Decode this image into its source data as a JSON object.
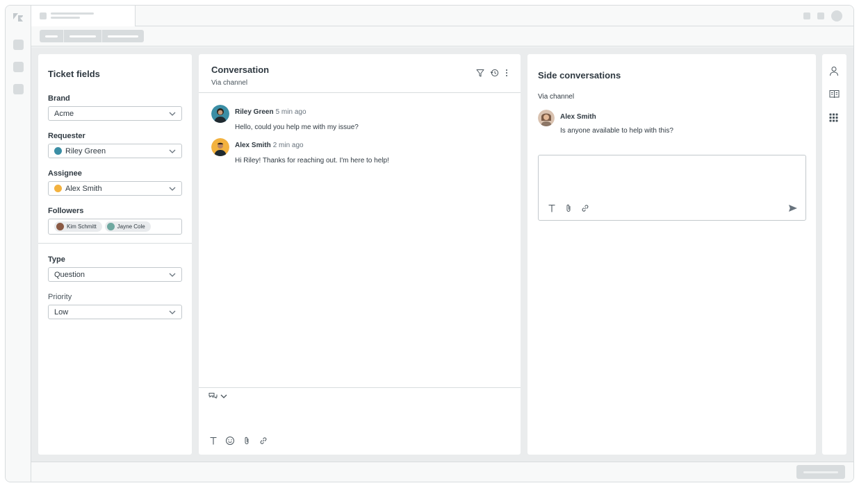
{
  "fields": {
    "title": "Ticket fields",
    "brand": {
      "label": "Brand",
      "value": "Acme"
    },
    "requester": {
      "label": "Requester",
      "value": "Riley Green"
    },
    "assignee": {
      "label": "Assignee",
      "value": "Alex Smith"
    },
    "followers": {
      "label": "Followers",
      "items": [
        "Kim Schmitt",
        "Jayne Cole"
      ]
    },
    "type": {
      "label": "Type",
      "value": "Question"
    },
    "priority": {
      "label": "Priority",
      "value": "Low"
    }
  },
  "conversation": {
    "title": "Conversation",
    "via": "Via channel",
    "messages": [
      {
        "author": "Riley Green",
        "time": "5 min ago",
        "text": "Hello, could you help me with my issue?"
      },
      {
        "author": "Alex Smith",
        "time": "2 min ago",
        "text": "Hi Riley! Thanks for reaching out. I'm here to help!"
      }
    ]
  },
  "side": {
    "title": "Side conversations",
    "via": "Via channel",
    "message": {
      "author": "Alex Smith",
      "text": "Is anyone available to help with this?"
    }
  },
  "colors": {
    "accent": "#2f3941",
    "border": "#d8dcde",
    "workspace": "#eaeced"
  }
}
